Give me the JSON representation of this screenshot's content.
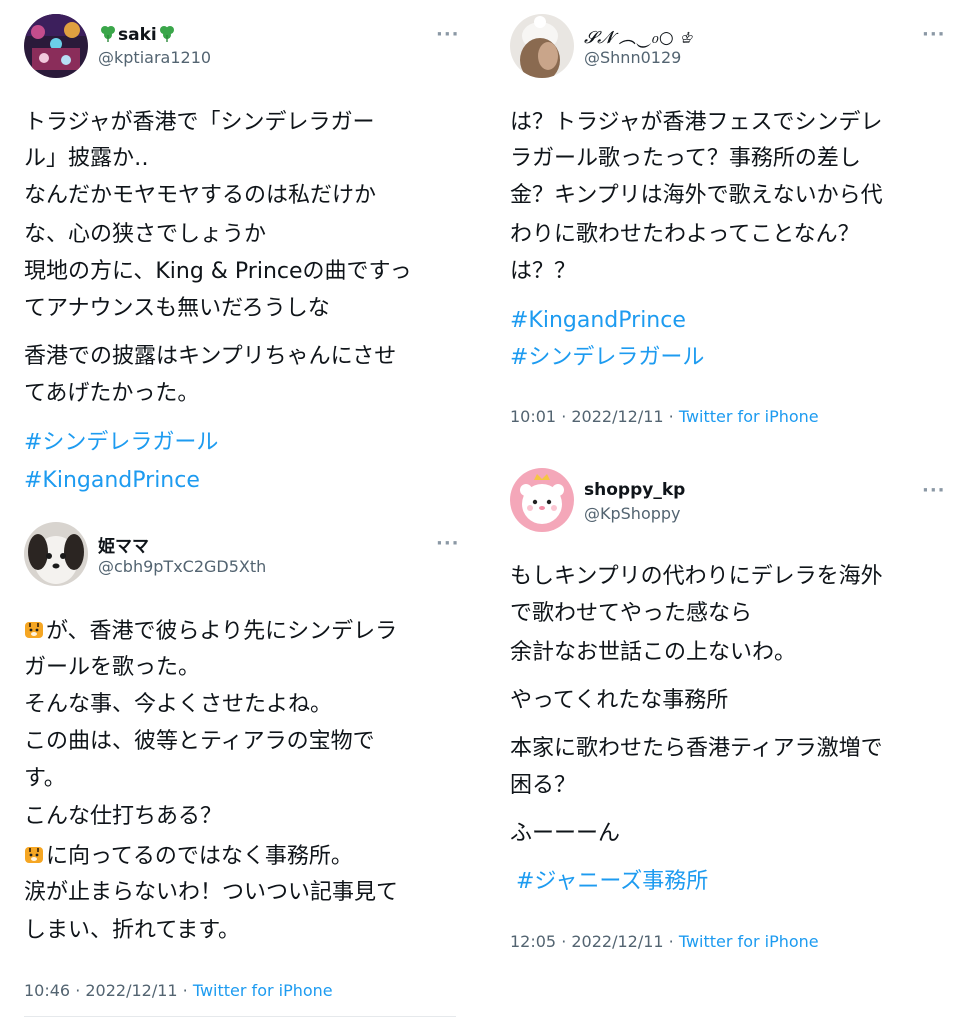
{
  "tweets": {
    "saki": {
      "name": "saki",
      "handle": "@kptiara1210",
      "lines": [
        "トラジャが香港で「シンデレラガー",
        "ル」披露か‥",
        "なんだかモヤモヤするのは私だけか",
        "な、心の狭さでしょうか",
        "現地の方に、King & Princeの曲ですっ",
        "てアナウンスも無いだろうしな",
        "香港での披露はキンプリちゃんにさせ",
        "てあげたかった。"
      ],
      "tags": [
        "#シンデレラガール",
        "#KingandPrince"
      ]
    },
    "shnn": {
      "name": "𝓢𝓝 ︵‿₀○ ♔",
      "handle": "@Shnn0129",
      "lines": [
        "は？トラジャが香港フェスでシンデレ",
        "ラガール歌ったって？事務所の差し",
        "金？キンプリは海外で歌えないから代",
        "わりに歌わせたわよってことなん？",
        "は？？"
      ],
      "tags": [
        "#KingandPrince",
        "#シンデレラガール"
      ],
      "time": "10:01 · 2022/12/11 · ",
      "source": "Twitter for iPhone"
    },
    "hime": {
      "name": "姫ママ",
      "handle": "@cbh9pTxC2GD5Xth",
      "lines": [
        "が、香港で彼らより先にシンデレラ",
        "ガールを歌った。",
        "そんな事、今よくさせたよね。",
        "この曲は、彼等とティアラの宝物で",
        "す。",
        "こんな仕打ちある？",
        "に向ってるのではなく事務所。",
        "涙が止まらないわ！ついつい記事見て",
        "しまい、折れてます。"
      ],
      "time": "10:46 · 2022/12/11 · ",
      "source": "Twitter for iPhone"
    },
    "shoppy": {
      "name": "shoppy_kp",
      "handle": "@KpShoppy",
      "lines": [
        "もしキンプリの代わりにデレラを海外",
        "で歌わせてやった感なら",
        "余計なお世話この上ないわ。",
        "やってくれたな事務所",
        "本家に歌わせたら香港ティアラ激増で",
        "困る？",
        "ふーーーん"
      ],
      "tags": [
        "#ジャニーズ事務所"
      ],
      "time": "12:05 · 2022/12/11 · ",
      "source": "Twitter for iPhone"
    },
    "more_label": "···"
  },
  "colors": {
    "text": "#0f1419",
    "secondary": "#536471",
    "link": "#1d9bf0"
  },
  "icons": [
    "clover-icon",
    "tiger-icon",
    "more-icon"
  ]
}
